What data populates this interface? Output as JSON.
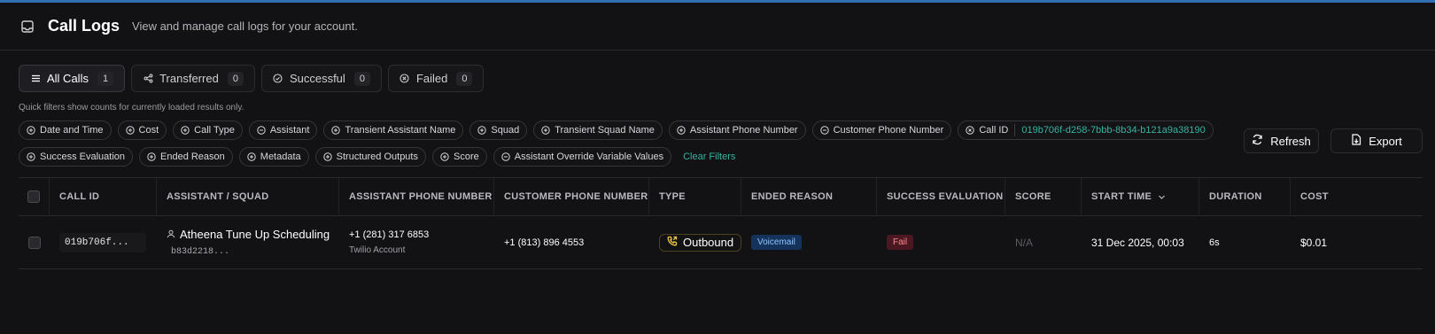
{
  "header": {
    "title": "Call Logs",
    "subtitle": "View and manage call logs for your account."
  },
  "tabs": [
    {
      "label": "All Calls",
      "count": "1",
      "icon": "list-icon",
      "active": true
    },
    {
      "label": "Transferred",
      "count": "0",
      "icon": "share-icon"
    },
    {
      "label": "Successful",
      "count": "0",
      "icon": "check-circle-icon"
    },
    {
      "label": "Failed",
      "count": "0",
      "icon": "x-circle-icon"
    }
  ],
  "hint": "Quick filters show counts for currently loaded results only.",
  "filters": {
    "row1": [
      "Date and Time",
      "Cost",
      "Call Type",
      "Assistant",
      "Transient Assistant Name",
      "Squad",
      "Transient Squad Name",
      "Assistant Phone Number",
      "Customer Phone Number"
    ],
    "call_id_label": "Call ID",
    "call_id_value": "019b706f-d258-7bbb-8b34-b121a9a38190",
    "row2": [
      "Success Evaluation",
      "Ended Reason",
      "Metadata",
      "Structured Outputs",
      "Score",
      "Assistant Override Variable Values"
    ],
    "clear_label": "Clear Filters"
  },
  "actions": {
    "refresh_label": "Refresh",
    "export_label": "Export"
  },
  "table": {
    "columns": [
      "Call ID",
      "Assistant / Squad",
      "Assistant Phone Number",
      "Customer Phone Number",
      "Type",
      "Ended Reason",
      "Success Evaluation",
      "Score",
      "Start Time",
      "Duration",
      "Cost"
    ],
    "rows": [
      {
        "call_id": "019b706f...",
        "assistant_name": "Atheena Tune Up Scheduling",
        "assistant_id": "b83d2218...",
        "assistant_phone": "+1 (281) 317 6853",
        "assistant_phone_sub": "Twilio Account",
        "customer_phone": "+1 (813) 896 4553",
        "type": "Outbound",
        "ended_reason": "Voicemail",
        "success_evaluation": "Fail",
        "score": "N/A",
        "start_time": "31 Dec 2025, 00:03",
        "duration": "6s",
        "cost": "$0.01"
      }
    ]
  },
  "colors": {
    "accent": "#37b3a0",
    "background": "#121214",
    "top_bar": "#2f6fb3"
  }
}
